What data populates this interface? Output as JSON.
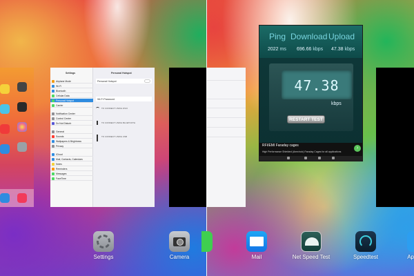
{
  "left_panel": {
    "settings_card": {
      "sidebar_title": "Settings",
      "detail_title": "Personal Hotspot",
      "sidebar_items": [
        "Airplane Mode",
        "Wi-Fi",
        "Bluetooth",
        "Cellular Data",
        "Personal Hotspot",
        "Carrier",
        "Notification Center",
        "Control Center",
        "Do Not Disturb",
        "General",
        "Sounds",
        "Wallpapers & Brightness",
        "Privacy",
        "iCloud",
        "Mail, Contacts, Calendars",
        "Notes",
        "Reminders",
        "Messages",
        "FaceTime"
      ],
      "detail_rows": [
        "Personal Hotspot",
        "Wi-Fi Password"
      ],
      "detail_sections": [
        "TO CONNECT USING WI-FI",
        "TO CONNECT USING BLUETOOTH",
        "TO CONNECT USING USB"
      ]
    },
    "dock": [
      {
        "label": "Settings",
        "icon": "gear-icon"
      },
      {
        "label": "Camera",
        "icon": "camera-icon"
      }
    ]
  },
  "right_panel": {
    "speedtest_card": {
      "headers": [
        "Ping",
        "Download",
        "Upload"
      ],
      "ping_value": "2022",
      "ping_unit": "ms",
      "download_value": "696.66",
      "download_unit": "kbps",
      "upload_value": "47.38",
      "upload_unit": "kbps",
      "gauge_value": "47.38",
      "gauge_unit": "kbps",
      "restart_label": "RESTART TEST",
      "ad_title": "RFI/EMI Faraday cages",
      "ad_text": "High Performance Shielded (Anechoic) Faraday Cages for all applications"
    },
    "dock": [
      {
        "label": "Mail",
        "icon": "mail-icon"
      },
      {
        "label": "Net Speed Test",
        "icon": "speedometer-icon"
      },
      {
        "label": "Speedtest",
        "icon": "gauge-icon"
      },
      {
        "label": "Ap",
        "icon": "app-icon"
      }
    ]
  }
}
